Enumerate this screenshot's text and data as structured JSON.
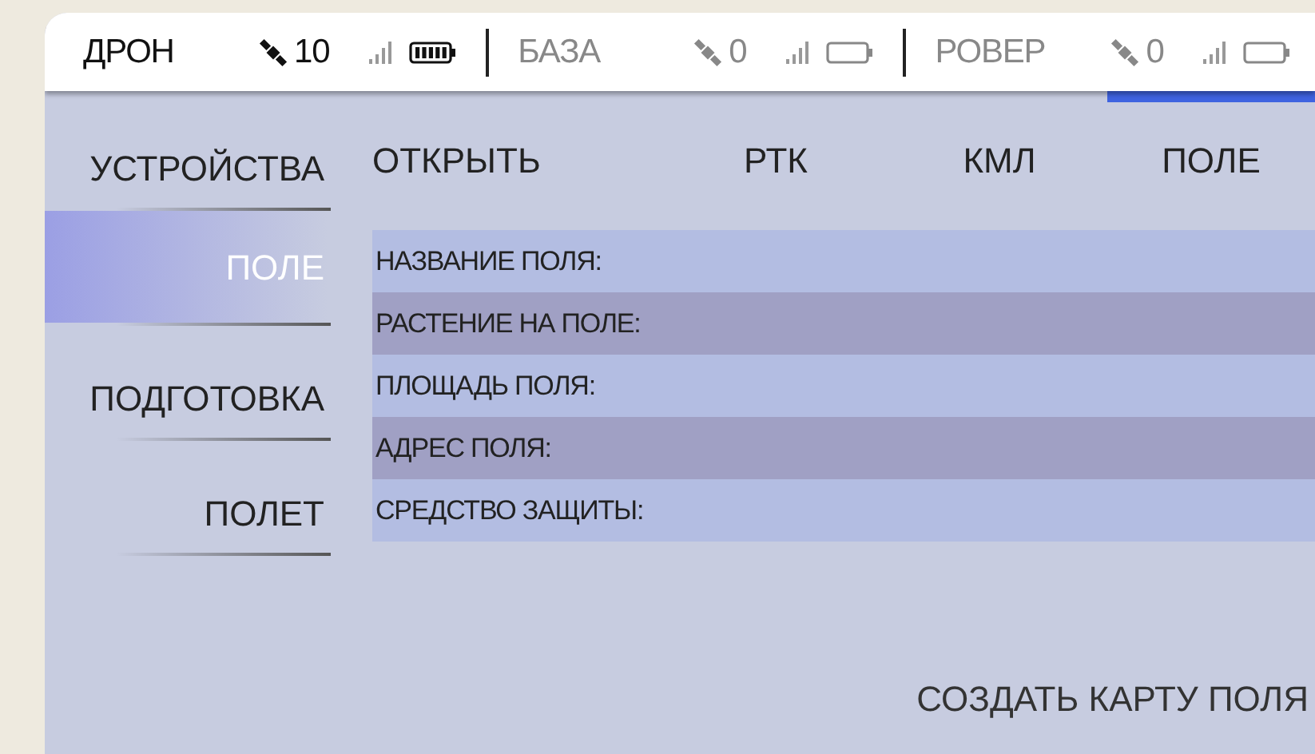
{
  "status_bar": {
    "devices": [
      {
        "name": "ДРОН",
        "satellites": "10",
        "active": true,
        "battery_charged": true
      },
      {
        "name": "БАЗА",
        "satellites": "0",
        "active": false,
        "battery_charged": false
      },
      {
        "name": "РОВЕР",
        "satellites": "0",
        "active": false,
        "battery_charged": false
      }
    ]
  },
  "sidebar": {
    "items": [
      {
        "label": "УСТРОЙСТВА",
        "selected": false
      },
      {
        "label": "ПОЛЕ",
        "selected": true
      },
      {
        "label": "ПОДГОТОВКА",
        "selected": false
      },
      {
        "label": "ПОЛЕТ",
        "selected": false
      }
    ]
  },
  "tabs": [
    {
      "label": "ОТКРЫТЬ",
      "selected": false
    },
    {
      "label": "РТК",
      "selected": false
    },
    {
      "label": "КМЛ",
      "selected": false
    },
    {
      "label": "ПОЛЕ",
      "selected": true
    }
  ],
  "fields": [
    {
      "label": "НАЗВАНИЕ ПОЛЯ:"
    },
    {
      "label": "РАСТЕНИЕ НА ПОЛЕ:"
    },
    {
      "label": "ПЛОЩАДЬ ПОЛЯ:"
    },
    {
      "label": "АДРЕС ПОЛЯ:"
    },
    {
      "label": "СРЕДСТВО ЗАЩИТЫ:"
    }
  ],
  "create_button": {
    "label": "СОЗДАТЬ КАРТУ ПОЛЯ"
  }
}
